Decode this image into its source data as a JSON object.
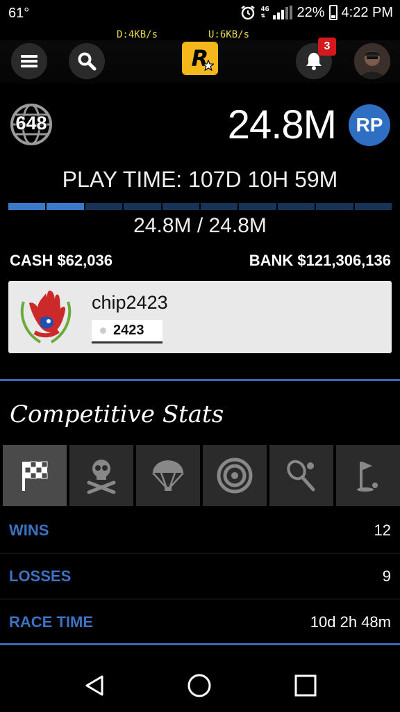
{
  "status_bar": {
    "temperature": "61°",
    "network_type": "4G",
    "battery": "22%",
    "time": "4:22 PM"
  },
  "net_speed": {
    "download": "D:4KB/s",
    "upload": "U:6KB/s"
  },
  "header": {
    "logo_letter": "R",
    "notification_count": "3"
  },
  "profile": {
    "rank": "648",
    "rp": "24.8M",
    "rp_badge": "RP",
    "play_time": "PLAY TIME: 107D 10H 59M",
    "rp_progress": "24.8M / 24.8M",
    "progress_fraction": 0.2,
    "cash": "CASH $62,036",
    "bank": "BANK $121,306,136"
  },
  "crew": {
    "name": "chip2423",
    "tag": "2423"
  },
  "competitive": {
    "title": "Competitive Stats",
    "tabs": [
      "race-flag-icon",
      "skull-crossbones-icon",
      "parachute-icon",
      "target-icon",
      "tennis-icon",
      "golf-icon"
    ],
    "stats": [
      {
        "label": "WINS",
        "value": "12"
      },
      {
        "label": "LOSSES",
        "value": "9"
      },
      {
        "label": "RACE TIME",
        "value": "10d 2h 48m"
      }
    ]
  },
  "colors": {
    "accent_blue": "#3d72c2",
    "rockstar_yellow": "#f5b81c",
    "badge_red": "#d4191e"
  }
}
